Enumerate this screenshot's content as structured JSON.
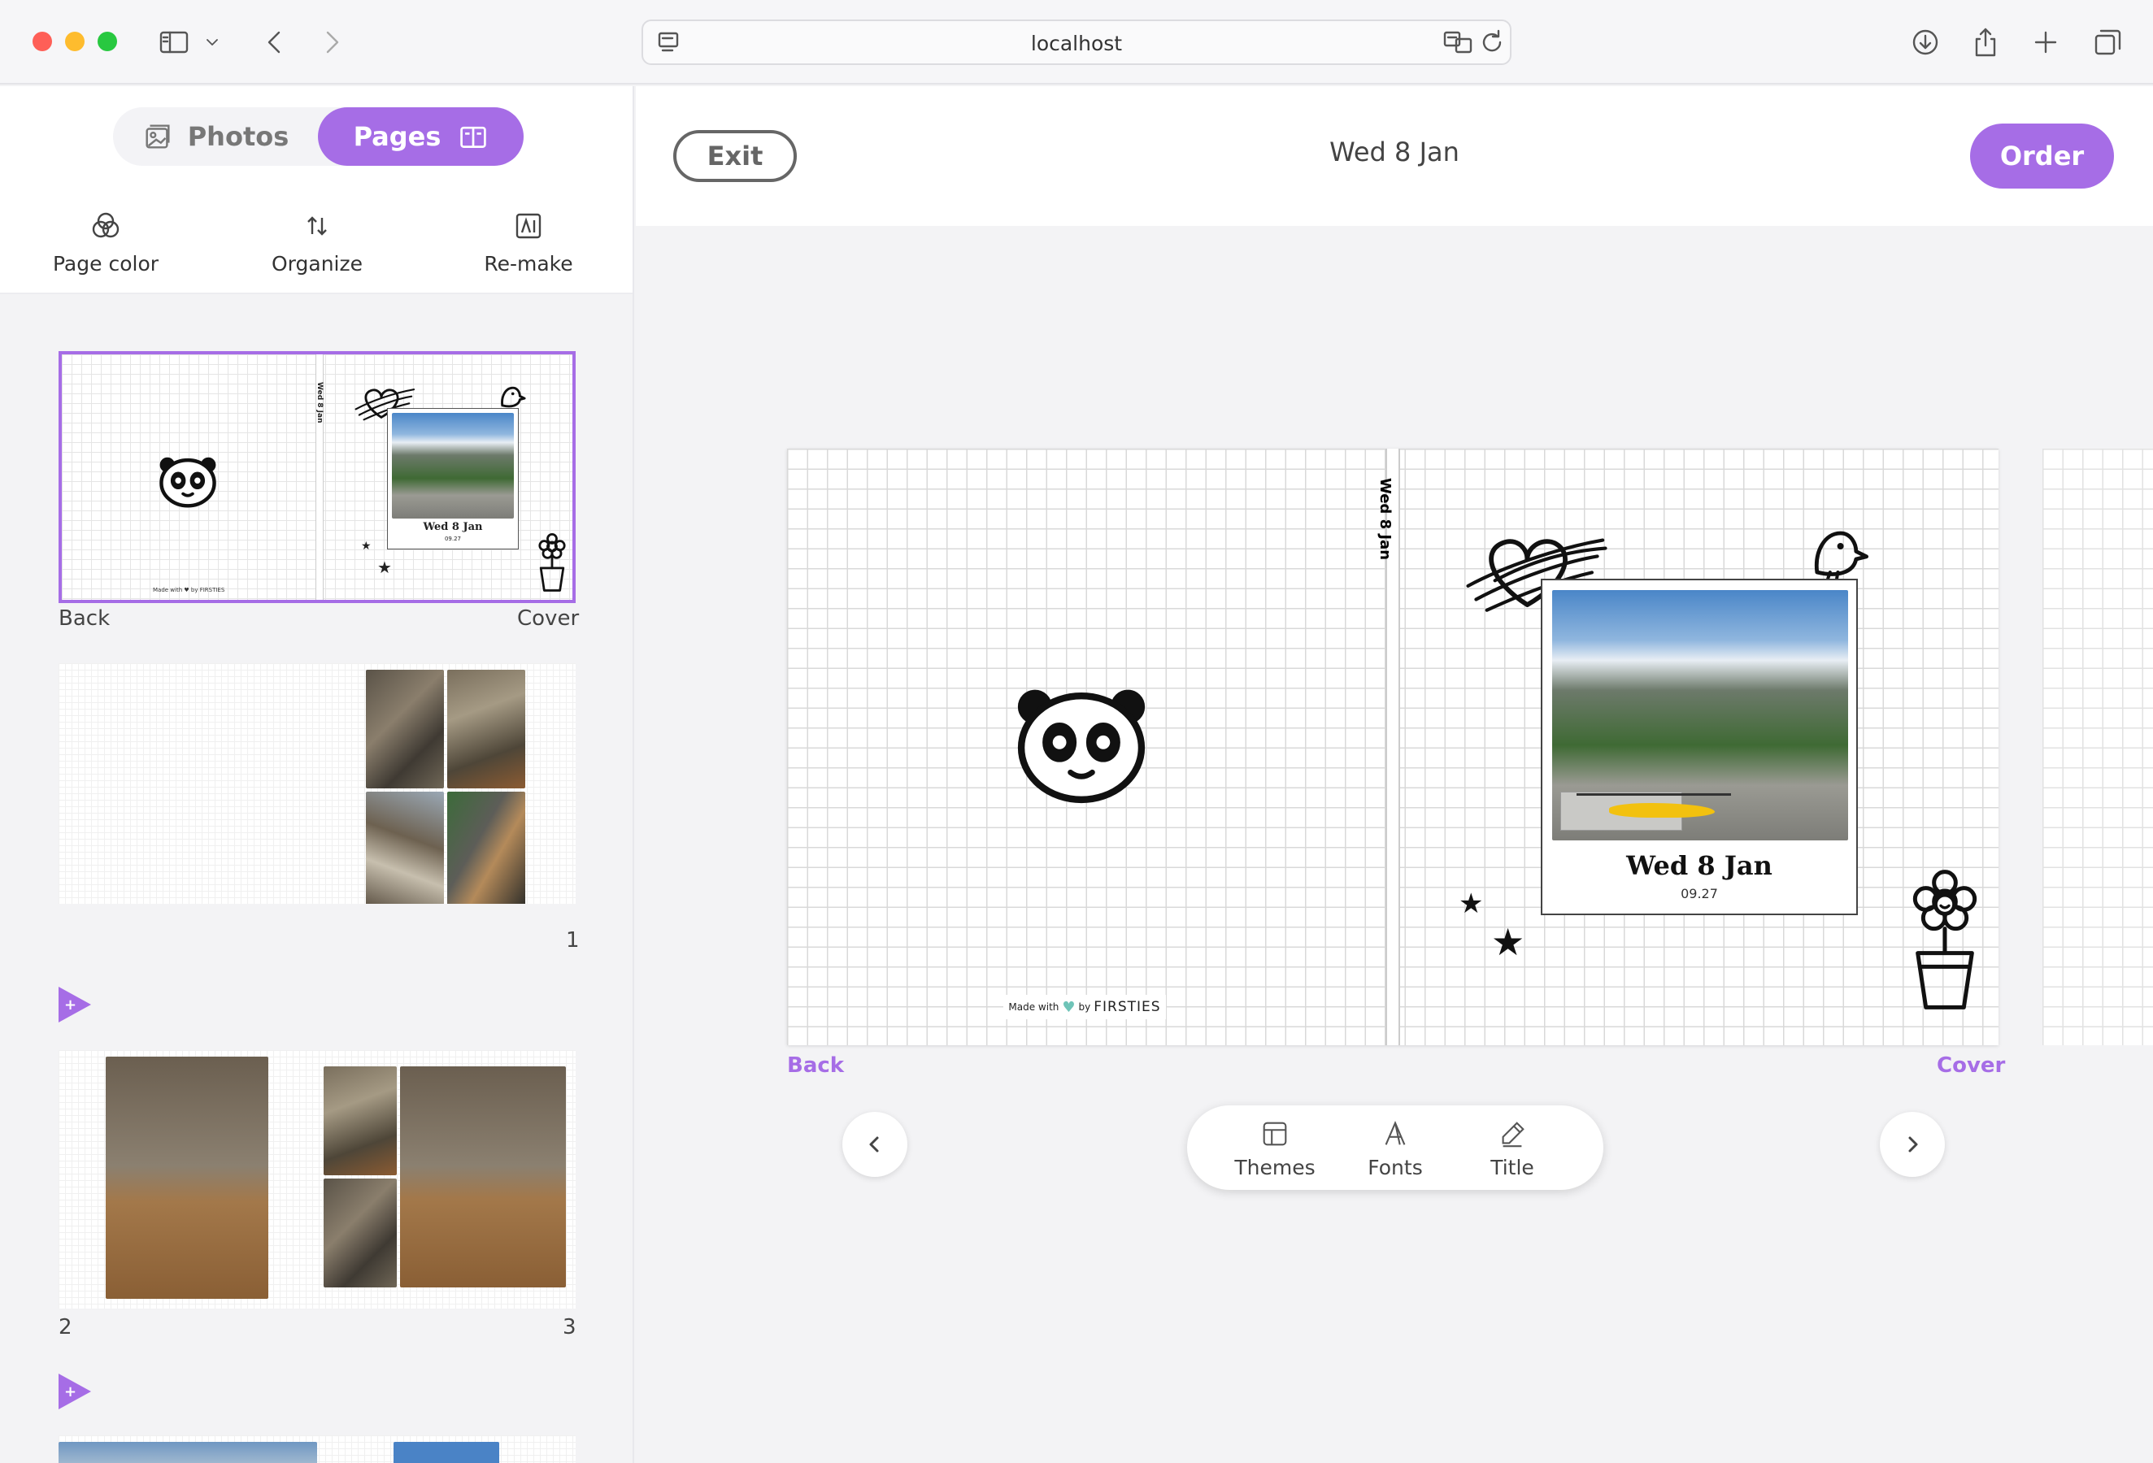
{
  "browser": {
    "url": "localhost"
  },
  "sidebar": {
    "tabs": {
      "photos_label": "Photos",
      "pages_label": "Pages"
    },
    "tools": [
      {
        "label": "Page color",
        "icon": "page-color-icon"
      },
      {
        "label": "Organize",
        "icon": "organize-icon"
      },
      {
        "label": "Re-make",
        "icon": "remake-icon"
      }
    ],
    "thumbnails": [
      {
        "left_label": "Back",
        "right_label": "Cover",
        "spine": "Wed 8 Jan",
        "photo_title": "Wed 8 Jan",
        "photo_time": "09.27",
        "footer": "Made with ♥ by FIRSTIES"
      },
      {
        "left_label": "",
        "right_label": "1"
      },
      {
        "left_label": "2",
        "right_label": "3"
      }
    ]
  },
  "header": {
    "exit_label": "Exit",
    "title": "Wed 8 Jan",
    "order_label": "Order"
  },
  "spread": {
    "spine_text": "Wed 8 Jan",
    "photo_title": "Wed 8 Jan",
    "photo_time": "09.27",
    "made_with": "Made with",
    "by": "by",
    "brand": "FIRSTIES",
    "left_label": "Back",
    "right_label": "Cover"
  },
  "toolbar": {
    "themes_label": "Themes",
    "fonts_label": "Fonts",
    "title_label": "Title"
  },
  "colors": {
    "accent": "#a66de6"
  }
}
